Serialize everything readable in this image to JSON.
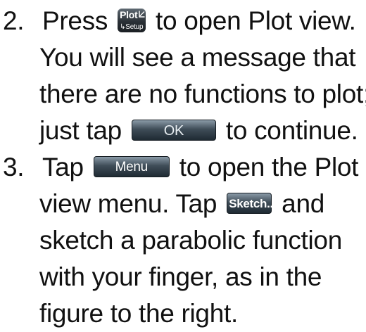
{
  "steps": [
    {
      "number": "2.",
      "line1_before": "Press",
      "plot_key": {
        "main": "Plot",
        "sub": "↳Setup",
        "icon": "plot-axes-icon"
      },
      "line1_after": "to open Plot view.",
      "line2": "You will see a message that",
      "line3": "there are no functions to plot;",
      "line4_before": "just tap",
      "ok_button": "OK",
      "line4_after": "to continue."
    },
    {
      "number": "3.",
      "line1_before": "Tap",
      "menu_button": "Menu",
      "line1_after": "to open the Plot",
      "line2_before": "view menu. Tap",
      "sketch_button": "Sketch..",
      "line2_after": "and",
      "line3": "sketch a parabolic function",
      "line4": "with your finger, as in the",
      "line5": "figure to the right."
    }
  ]
}
